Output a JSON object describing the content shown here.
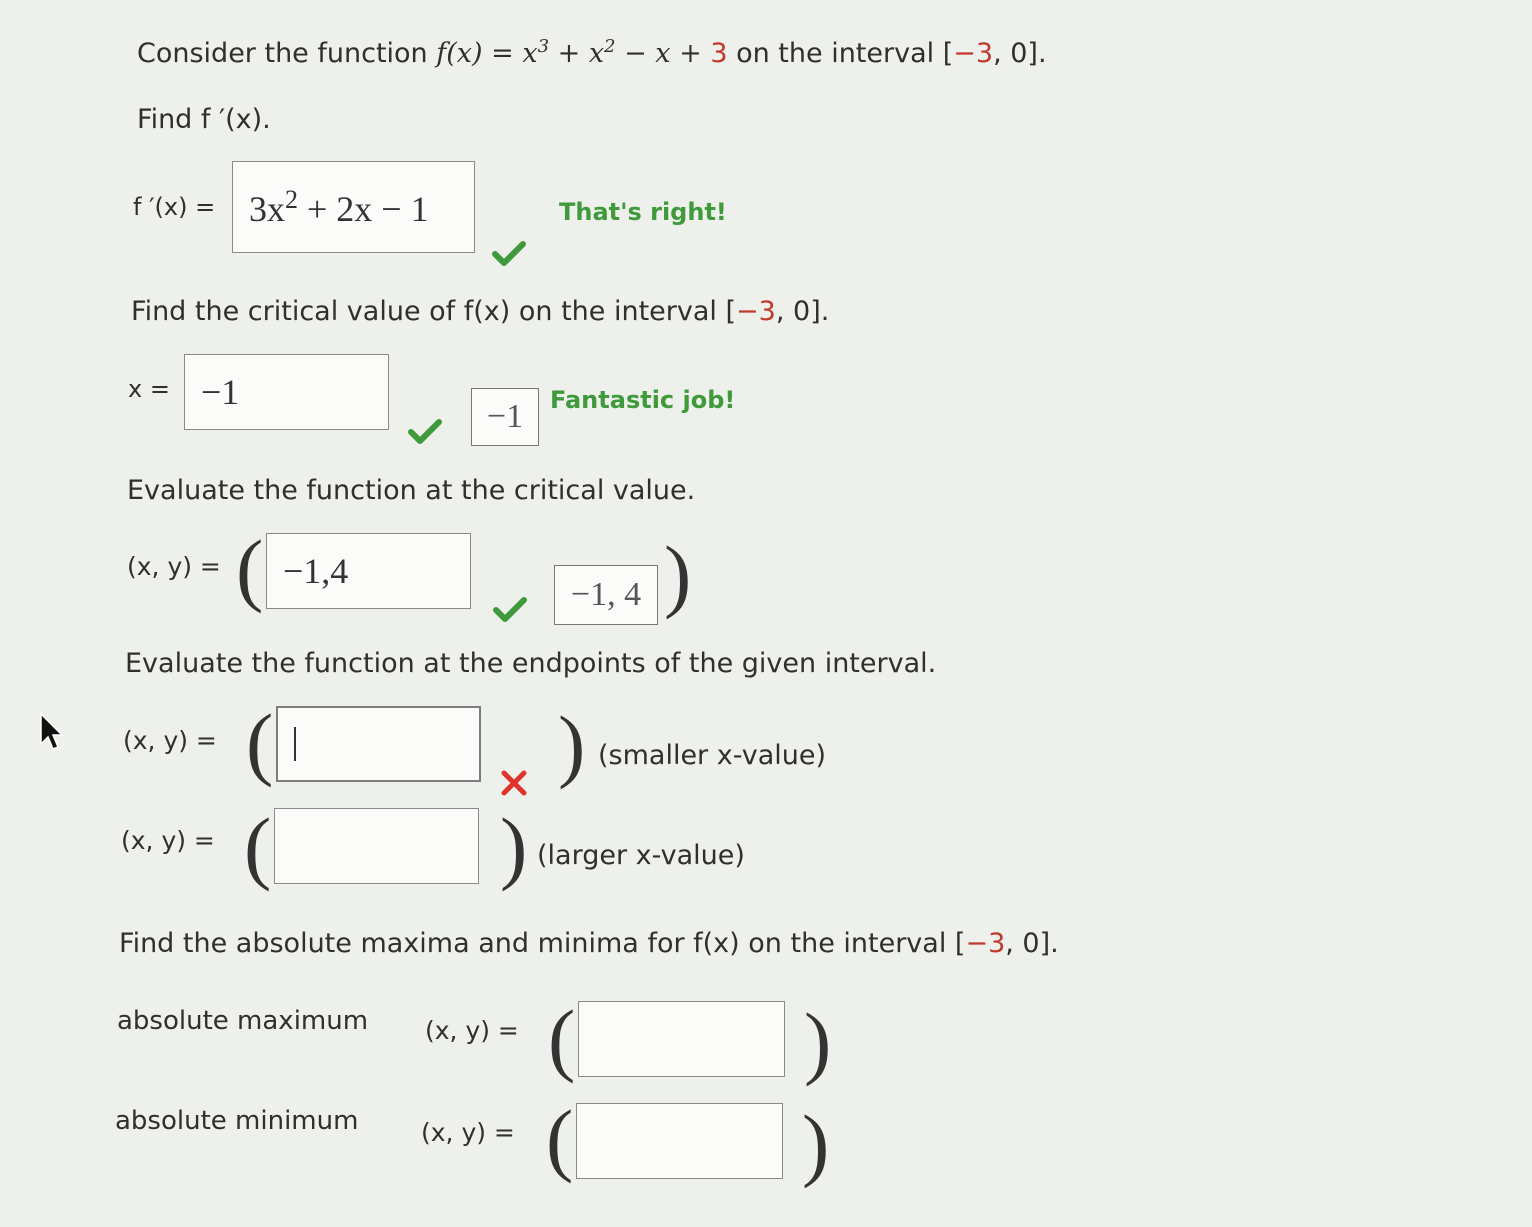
{
  "q1": {
    "prefix": "Consider the function ",
    "func": "f(x) = x3 + x2 − x + ",
    "const": "3",
    "mid": " on the interval [",
    "a": "−3",
    "sep": ", 0]."
  },
  "q2": {
    "prompt": "Find f ′(x).",
    "label": "f ′(x) =",
    "answer": "3x2 + 2x − 1",
    "feedback": "That's right!"
  },
  "q3": {
    "prompt_pre": "Find the critical value of f(x) on the interval [",
    "prompt_a": "−3",
    "prompt_post": ", 0].",
    "label": "x =",
    "answer": "−1",
    "preview": "−1",
    "feedback": "Fantastic job!"
  },
  "q4": {
    "prompt": "Evaluate the function at the critical value.",
    "label": "(x, y) =",
    "answer": "−1,4",
    "preview": "−1, 4"
  },
  "q5": {
    "prompt": "Evaluate the function at the endpoints of the given interval.",
    "label1": "(x, y) =",
    "value1": "",
    "note1": "(smaller x-value)",
    "label2": "(x, y) =",
    "value2": "",
    "note2": "(larger x-value)"
  },
  "q6": {
    "prompt_pre": "Find the absolute maxima and minima for f(x) on the interval [",
    "prompt_a": "−3",
    "prompt_post": ", 0].",
    "max_label": "absolute maximum",
    "max_xy": "(x, y) =",
    "max_value": "",
    "min_label": "absolute minimum",
    "min_xy": "(x, y) =",
    "min_value": ""
  },
  "colors": {
    "correct": "#3f9a3c",
    "incorrect": "#e0332b",
    "highlight": "#c0392b"
  },
  "icons": [
    "check-icon",
    "x-icon",
    "mouse-cursor-icon"
  ]
}
